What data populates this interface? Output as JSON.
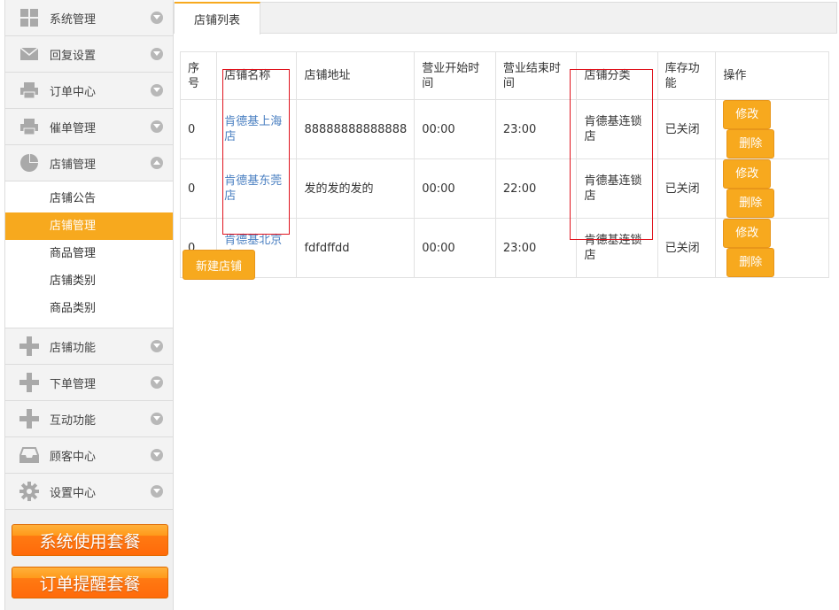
{
  "sidebar": {
    "items": [
      {
        "label": "系统管理"
      },
      {
        "label": "回复设置"
      },
      {
        "label": "订单中心"
      },
      {
        "label": "催单管理"
      },
      {
        "label": "店铺管理"
      },
      {
        "label": "店铺功能"
      },
      {
        "label": "下单管理"
      },
      {
        "label": "互动功能"
      },
      {
        "label": "顾客中心"
      },
      {
        "label": "设置中心"
      }
    ],
    "submenu": [
      {
        "label": "店铺公告"
      },
      {
        "label": "店铺管理"
      },
      {
        "label": "商品管理"
      },
      {
        "label": "店铺类别"
      },
      {
        "label": "商品类别"
      }
    ],
    "promo": {
      "system_package": "系统使用套餐",
      "order_alert_package": "订单提醒套餐"
    }
  },
  "tabs": [
    {
      "label": "店铺列表"
    }
  ],
  "table": {
    "headers": {
      "index": "序号",
      "name": "店铺名称",
      "address": "店铺地址",
      "open_time": "营业开始时间",
      "close_time": "营业结束时间",
      "category": "店铺分类",
      "inventory": "库存功能",
      "actions": "操作"
    },
    "rows": [
      {
        "index": "0",
        "name": "肯德基上海店",
        "address": "88888888888888",
        "open_time": "00:00",
        "close_time": "23:00",
        "category": "肯德基连锁店",
        "inventory": "已关闭",
        "edit": "修改",
        "delete": "删除"
      },
      {
        "index": "0",
        "name": "肯德基东莞店",
        "address": "发的发的发的",
        "open_time": "00:00",
        "close_time": "22:00",
        "category": "肯德基连锁店",
        "inventory": "已关闭",
        "edit": "修改",
        "delete": "删除"
      },
      {
        "index": "0",
        "name": "肯德基北京店",
        "address": "fdfdffdd",
        "open_time": "00:00",
        "close_time": "23:00",
        "category": "肯德基连锁店",
        "inventory": "已关闭",
        "edit": "修改",
        "delete": "删除"
      }
    ]
  },
  "new_store_label": "新建店铺",
  "colors": {
    "accent": "#f7a91e",
    "link": "#4a7fc1",
    "highlight_box": "#e0141e",
    "promo": "#ff7a12"
  }
}
